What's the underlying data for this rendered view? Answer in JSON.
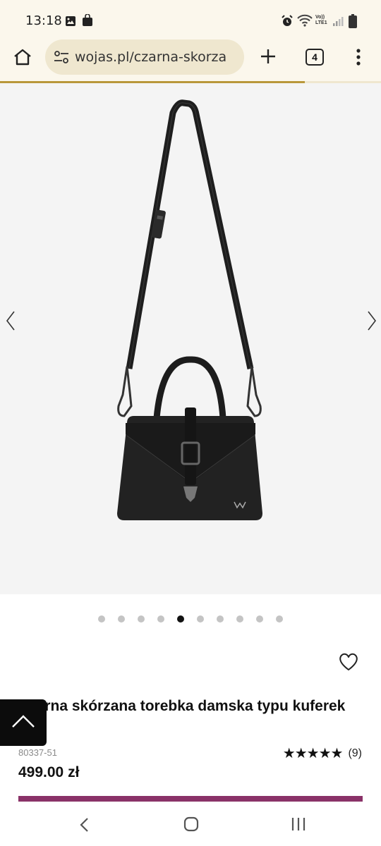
{
  "status_bar": {
    "time": "13:18",
    "icons": [
      "gallery-icon",
      "bag-icon",
      "alarm-icon",
      "wifi-icon",
      "volte-icon",
      "signal-icon",
      "battery-icon"
    ],
    "volte_label_top": "Vo))",
    "volte_label_bottom": "LTE1"
  },
  "browser": {
    "url": "wojas.pl/czarna-skorza",
    "tab_count": "4",
    "page_load_progress": 0.8,
    "accent_color": "#b9973a"
  },
  "gallery": {
    "image": "black-leather-handbag",
    "slide_count": 10,
    "active_slide": 5
  },
  "product": {
    "title": "Czarna skórzana torebka damska typu kuferek",
    "sku": "80337-51",
    "rating_stars": "★★★★★",
    "rating_value": 5,
    "rating_count": "(9)",
    "price": "499.00 zł",
    "cta_color": "#8a3268"
  }
}
